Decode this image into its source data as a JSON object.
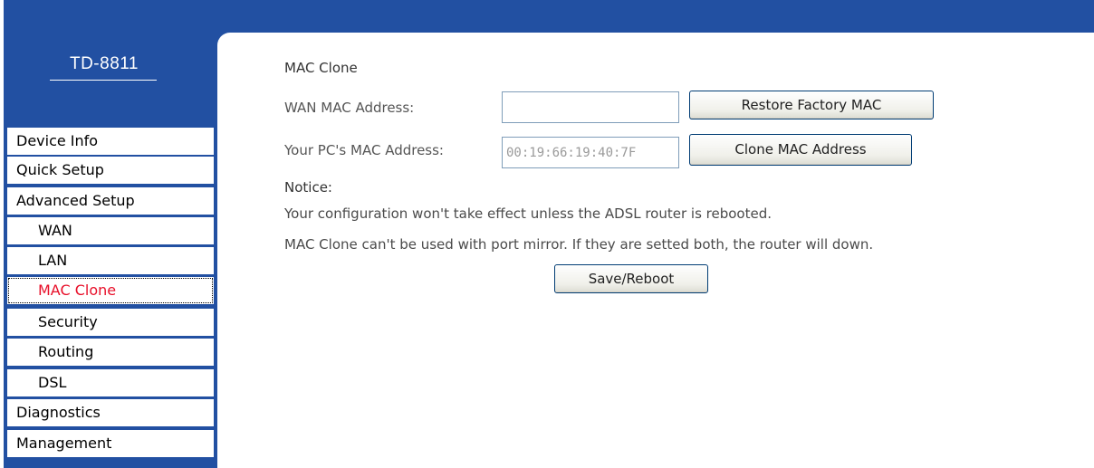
{
  "sidebar": {
    "model": "TD-8811",
    "items": [
      {
        "label": "Device Info"
      },
      {
        "label": "Quick Setup"
      },
      {
        "label": "Advanced Setup"
      },
      {
        "label": "WAN"
      },
      {
        "label": "LAN"
      },
      {
        "label": "MAC Clone"
      },
      {
        "label": "Security"
      },
      {
        "label": "Routing"
      },
      {
        "label": "DSL"
      },
      {
        "label": "Diagnostics"
      },
      {
        "label": "Management"
      }
    ],
    "active_item": "MAC Clone"
  },
  "main": {
    "section_title": "MAC Clone",
    "wan_mac_label": "WAN MAC Address:",
    "wan_mac_value": "",
    "restore_button": "Restore Factory MAC",
    "pc_mac_label": "Your PC's MAC Address:",
    "pc_mac_value": "00:19:66:19:40:7F",
    "clone_button": "Clone MAC Address",
    "notice_title": "Notice:",
    "notice_line1": "Your configuration won't take effect unless the ADSL router is rebooted.",
    "notice_line2": "MAC Clone can't be used with port mirror. If they are setted both, the router will down.",
    "save_button": "Save/Reboot"
  },
  "colors": {
    "brand_blue": "#2250a2",
    "active_red": "#e8102a"
  }
}
